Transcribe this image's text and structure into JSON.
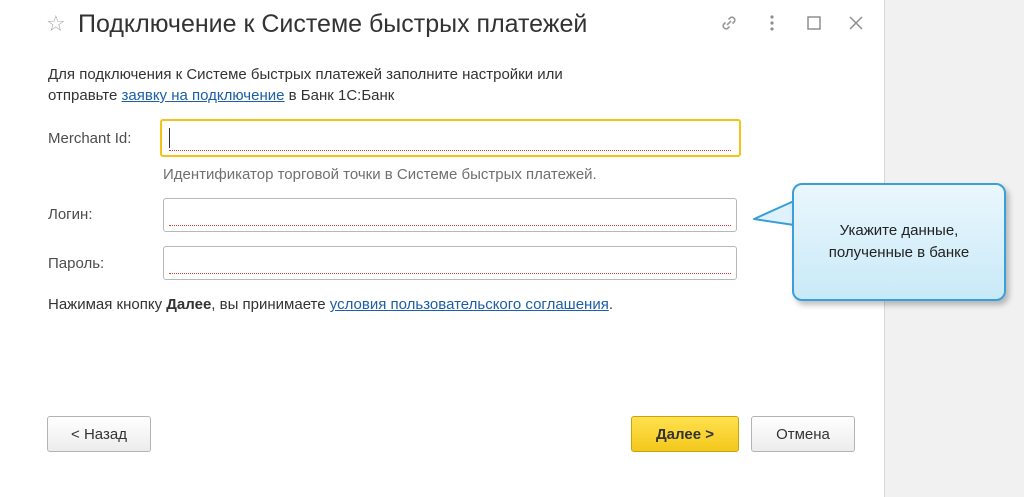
{
  "window": {
    "title": "Подключение к Системе быстрых платежей"
  },
  "header_icons": [
    "star-icon",
    "link-icon",
    "more-icon",
    "maximize-icon",
    "close-icon"
  ],
  "intro": {
    "line1": "Для подключения к Системе быстрых платежей заполните настройки  или",
    "line2_before": "отправьте ",
    "link": "заявку на подключение",
    "line2_after": " в Банк 1С:Банк"
  },
  "fields": {
    "merchant": {
      "label": "Merchant Id:",
      "value": "",
      "hint": "Идентификатор торговой точки в Системе быстрых платежей."
    },
    "login": {
      "label": "Логин:",
      "value": ""
    },
    "password": {
      "label": "Пароль:",
      "value": ""
    }
  },
  "terms": {
    "before": "Нажимая кнопку ",
    "bold": "Далее",
    "middle": ", вы принимаете ",
    "link": "условия пользовательского соглашения",
    "after": "."
  },
  "buttons": {
    "back": "< Назад",
    "next": "Далее >",
    "cancel": "Отмена"
  },
  "callout": {
    "line1": "Укажите данные,",
    "line2": "полученные в банке"
  },
  "colors": {
    "accent_yellow": "#f3c81c",
    "link_blue": "#1c5fa8",
    "callout_border": "#3a9ed8",
    "error_underline": "#e23b3b"
  }
}
